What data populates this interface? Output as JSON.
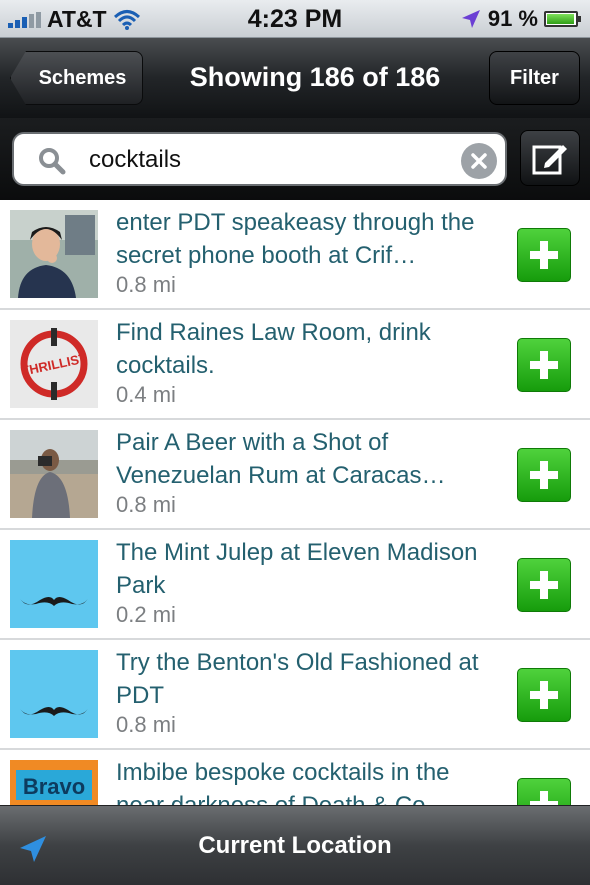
{
  "status_bar": {
    "carrier": "AT&T",
    "time": "4:23 PM",
    "battery_percent": "91 %",
    "battery_level": 0.91,
    "icons": [
      "signal-icon",
      "wifi-icon",
      "location-arrow-icon",
      "battery-icon"
    ]
  },
  "nav": {
    "back_label": "Schemes",
    "title": "Showing 186 of 186",
    "filter_label": "Filter"
  },
  "search": {
    "value": "cocktails",
    "placeholder": "",
    "icons": [
      "search-icon",
      "clear-icon",
      "compose-icon"
    ]
  },
  "items": [
    {
      "title": "enter PDT speakeasy through the secret phone booth at Crif…",
      "distance": "0.8 mi",
      "thumb": "person-photo"
    },
    {
      "title": "Find Raines Law Room, drink cocktails.",
      "distance": "0.4 mi",
      "thumb": "thrillist-logo",
      "thumb_text": "THRILLIST"
    },
    {
      "title": "Pair A Beer with a Shot of Venezuelan Rum at Caracas…",
      "distance": "0.8 mi",
      "thumb": "beach-photo"
    },
    {
      "title": "The Mint Julep at Eleven Madison Park",
      "distance": "0.2 mi",
      "thumb": "mustache"
    },
    {
      "title": "Try the Benton's Old Fashioned at PDT",
      "distance": "0.8 mi",
      "thumb": "mustache"
    },
    {
      "title": "Imbibe bespoke cocktails in the near darkness of Death & Co",
      "distance": "",
      "thumb": "bravo-logo",
      "thumb_text": "Bravo"
    }
  ],
  "toolbar": {
    "title": "Current Location",
    "icon": "location-arrow-icon"
  },
  "colors": {
    "link_text": "#24606f",
    "add_button": "#2db81f",
    "distance_text": "#7c7f82"
  }
}
